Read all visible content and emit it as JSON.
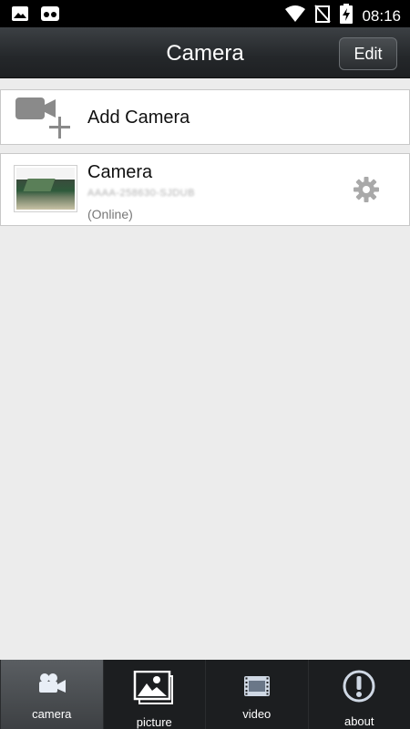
{
  "status_bar": {
    "time": "08:16",
    "icons": [
      "image-icon",
      "voicemail-icon",
      "wifi-icon",
      "no-sim-icon",
      "battery-charging-icon"
    ]
  },
  "header": {
    "title": "Camera",
    "edit_label": "Edit"
  },
  "add_camera": {
    "label": "Add Camera",
    "icon": "add-video-camera-icon"
  },
  "cameras": [
    {
      "name": "Camera",
      "uid": "AAAA-258630-SJDUB",
      "status": "(Online)",
      "settings_icon": "gear-icon"
    }
  ],
  "bottom_nav": {
    "tabs": [
      {
        "label": "camera",
        "icon": "camera-icon",
        "active": true
      },
      {
        "label": "picture",
        "icon": "picture-icon",
        "active": false
      },
      {
        "label": "video",
        "icon": "film-icon",
        "active": false
      },
      {
        "label": "about",
        "icon": "info-icon",
        "active": false
      }
    ]
  },
  "colors": {
    "background": "#ececec",
    "titlebar": "#24272a",
    "bottom_nav": "#1c1e20",
    "icon_gray": "#8a8a8a"
  }
}
